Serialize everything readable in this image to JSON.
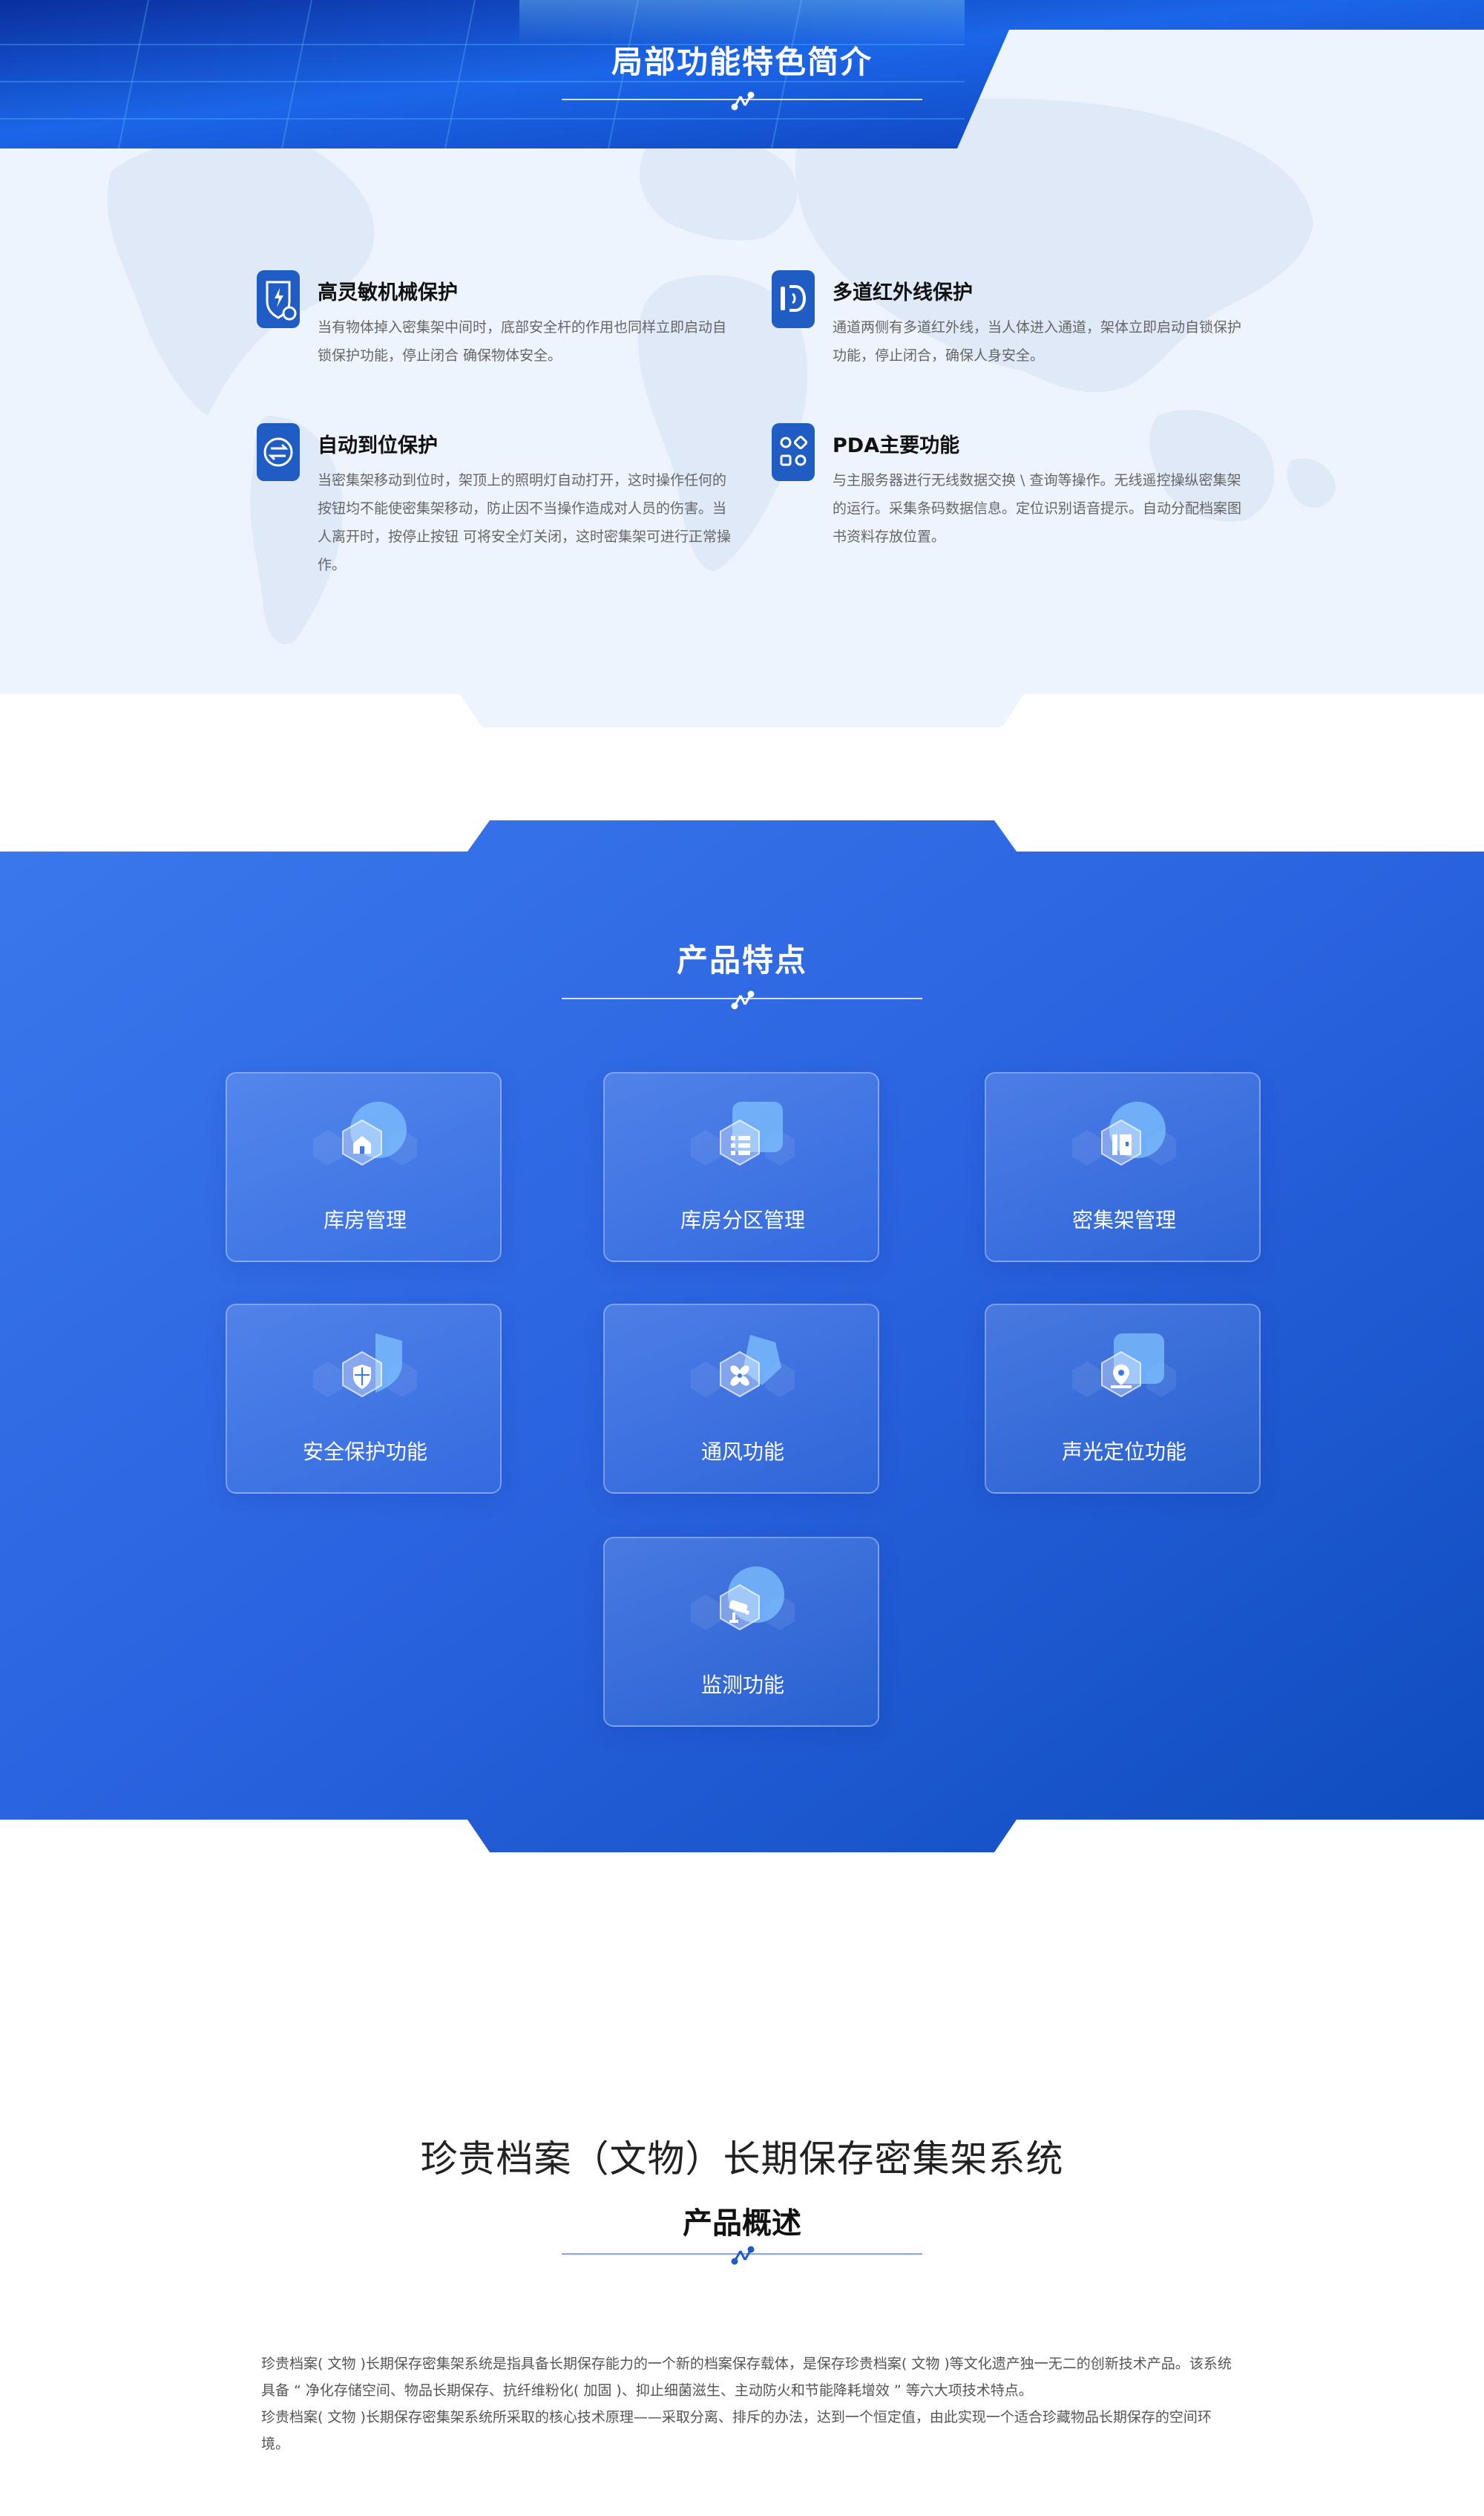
{
  "section1": {
    "title": "局部功能特色简介",
    "features": [
      {
        "icon": "shield-power-icon",
        "title": "高灵敏机械保护",
        "desc": "当有物体掉入密集架中间时，底部安全杆的作用也同样立即启动自锁保护功能，停止闭合 确保物体安全。"
      },
      {
        "icon": "infrared-icon",
        "title": "多道红外线保护",
        "desc": "通道两侧有多道红外线，当人体进入通道，架体立即启动自锁保护功能，停止闭合，确保人身安全。"
      },
      {
        "icon": "auto-position-icon",
        "title": "自动到位保护",
        "desc": "当密集架移动到位时，架顶上的照明灯自动打开，这时操作任何的按钮均不能使密集架移动，防止因不当操作造成对人员的伤害。当人离开时，按停止按钮 可将安全灯关闭，这时密集架可进行正常操作。"
      },
      {
        "icon": "pda-apps-icon",
        "title": "PDA主要功能",
        "desc": "与主服务器进行无线数据交换 \\ 查询等操作。无线遥控操纵密集架的运行。采集条码数据信息。定位识别语音提示。自动分配档案图书资料存放位置。"
      }
    ]
  },
  "section2": {
    "title": "产品特点",
    "cards": [
      {
        "icon": "home-icon",
        "label": "库房管理"
      },
      {
        "icon": "list-icon",
        "label": "库房分区管理"
      },
      {
        "icon": "cabinet-icon",
        "label": "密集架管理"
      },
      {
        "icon": "shield-icon",
        "label": "安全保护功能"
      },
      {
        "icon": "fan-icon",
        "label": "通风功能"
      },
      {
        "icon": "location-icon",
        "label": "声光定位功能"
      },
      {
        "icon": "camera-icon",
        "label": "监测功能"
      }
    ]
  },
  "section3": {
    "heading": "珍贵档案（文物）长期保存密集架系统",
    "subtitle": "产品概述",
    "paragraphs": [
      "珍贵档案( 文物 )长期保存密集架系统是指具备长期保存能力的一个新的档案保存载体，是保存珍贵档案( 文物 )等文化遗产独一无二的创新技术产品。该系统具备 “ 净化存储空间、物品长期保存、抗纤维粉化( 加固 )、抑止细菌滋生、主动防火和节能降耗增效 ” 等六大项技术特点。",
      "珍贵档案( 文物 )长期保存密集架系统所采取的核心技术原理——采取分离、排斥的办法，达到一个恒定值，由此实现一个适合珍藏物品长期保存的空间环境。"
    ]
  },
  "colors": {
    "accent": "#2f6de0",
    "deep_blue": "#0e4cb8",
    "icon_blue": "#1f5cc4"
  }
}
